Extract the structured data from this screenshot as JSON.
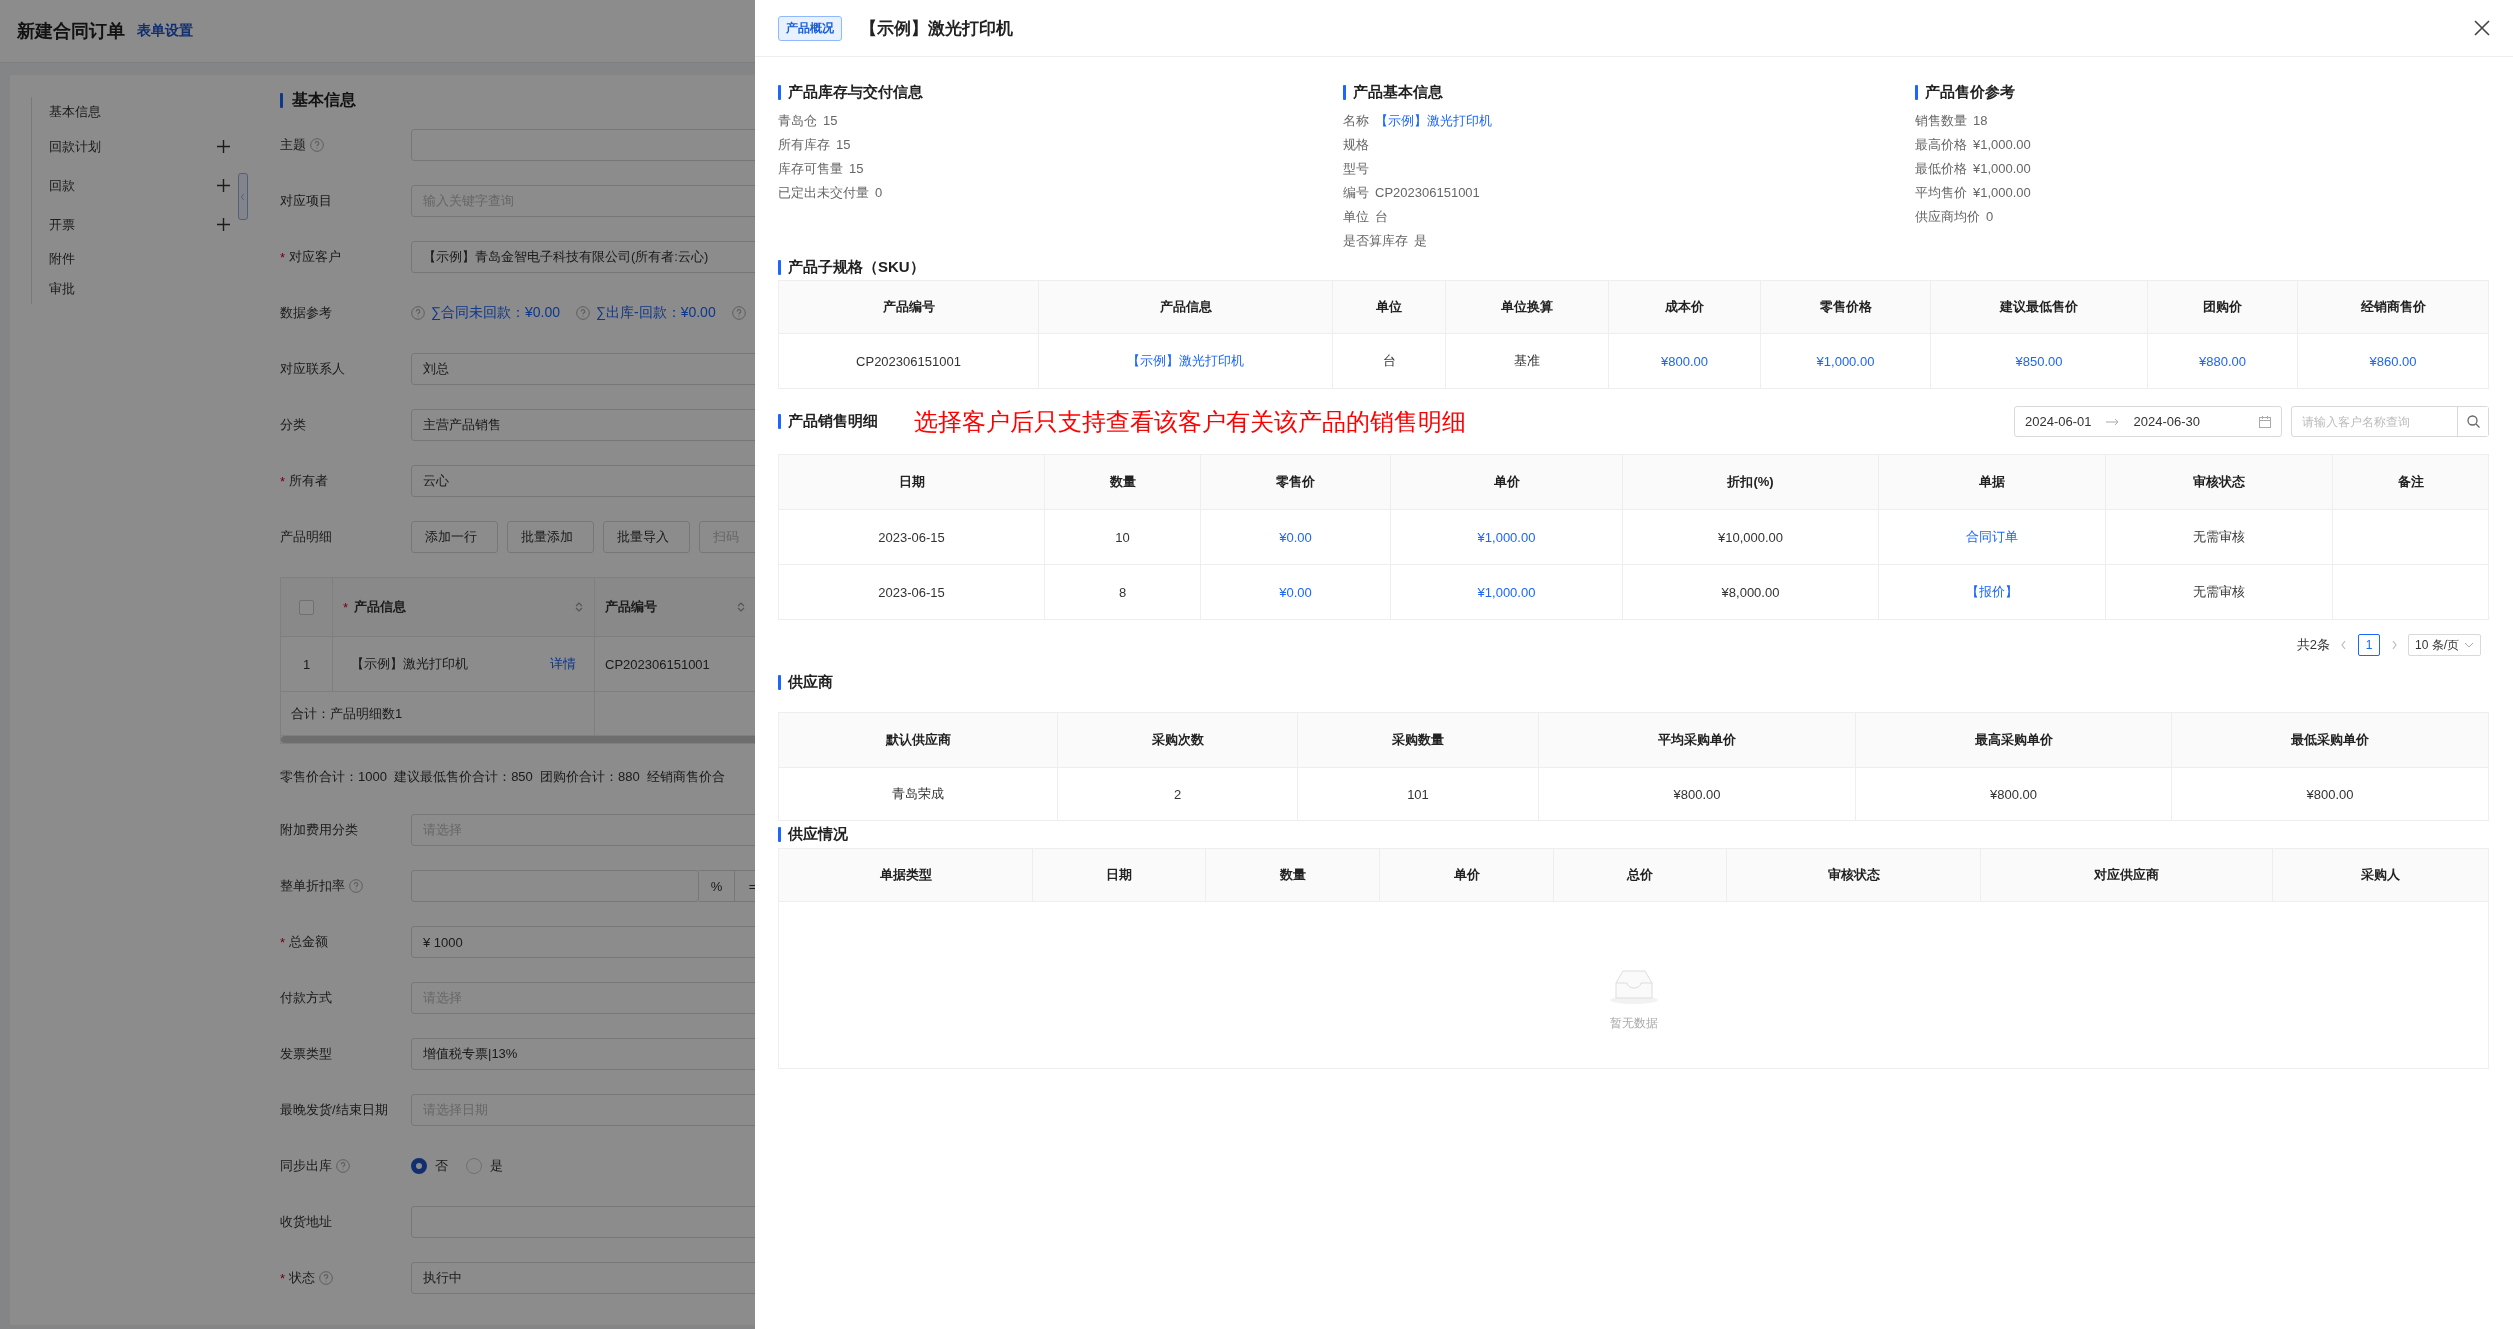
{
  "page": {
    "title": "新建合同订单",
    "settings_link": "表单设置"
  },
  "side_nav": [
    {
      "label": "基本信息",
      "addable": false
    },
    {
      "label": "回款计划",
      "addable": true
    },
    {
      "label": "回款",
      "addable": true
    },
    {
      "label": "开票",
      "addable": true
    },
    {
      "label": "附件",
      "addable": false
    },
    {
      "label": "审批",
      "addable": false
    }
  ],
  "form": {
    "section_title": "基本信息",
    "rows": [
      {
        "kind": "input",
        "label": "主题",
        "help": true
      },
      {
        "kind": "input",
        "label": "对应项目",
        "help": false,
        "placeholder": "输入关键字查询"
      },
      {
        "kind": "input",
        "label": "对应客户",
        "required_mark": "*",
        "help": false,
        "value": "【示例】青岛金智电子科技有限公司(所有者:云心)"
      },
      {
        "kind": "refs",
        "label": "数据参考",
        "help": false,
        "refs": [
          "∑合同未回款：¥0.00",
          "∑出库-回款：¥0.00"
        ]
      },
      {
        "kind": "input",
        "label": "对应联系人",
        "help": false,
        "value": "刘总"
      },
      {
        "kind": "input",
        "label": "分类",
        "help": false,
        "value": "主营产品销售"
      },
      {
        "kind": "input",
        "label": "所有者",
        "required_mark": "*",
        "help": false,
        "value": "云心"
      },
      {
        "kind": "buttons",
        "label": "产品明细",
        "help": false,
        "buttons": [
          {
            "label": "添加一行",
            "disabled": false
          },
          {
            "label": "批量添加",
            "disabled": false
          },
          {
            "label": "批量导入",
            "disabled": false
          },
          {
            "label": "扫码",
            "disabled": true
          }
        ]
      },
      {
        "kind": "table",
        "select_all_checked": false,
        "columns": [
          {
            "label": "产品信息",
            "required_mark": "*"
          },
          {
            "label": "产品编号"
          }
        ],
        "rows": [
          {
            "index": "1",
            "product": "【示例】激光打印机",
            "link": "详情",
            "code": "CP202306151001"
          }
        ],
        "footer": "合计：产品明细数1"
      },
      {
        "kind": "totals",
        "text": "零售价合计：1000  建议最低售价合计：850  团购价合计：880  经销商售价合"
      },
      {
        "kind": "input",
        "label": "附加费用分类",
        "help": false,
        "placeholder": "请选择"
      },
      {
        "kind": "discount",
        "label": "整单折扣率",
        "help": true,
        "suffix": "%",
        "tail": "="
      },
      {
        "kind": "input",
        "label": "总金额",
        "required_mark": "*",
        "help": false,
        "value": "¥ 1000"
      },
      {
        "kind": "input",
        "label": "付款方式",
        "help": false,
        "placeholder": "请选择"
      },
      {
        "kind": "input",
        "label": "发票类型",
        "help": false,
        "value": "增值税专票|13%"
      },
      {
        "kind": "input",
        "label": "最晚发货/结束日期",
        "help": false,
        "placeholder": "请选择日期"
      },
      {
        "kind": "radio",
        "label": "同步出库",
        "help": true,
        "options": [
          {
            "label": "否",
            "selected": true
          },
          {
            "label": "是",
            "selected": false
          }
        ]
      },
      {
        "kind": "input",
        "label": "收货地址",
        "help": false
      },
      {
        "kind": "input",
        "label": "状态",
        "required_mark": "*",
        "help": true,
        "value": "执行中"
      }
    ]
  },
  "drawer": {
    "tag": "产品概况",
    "title": "【示例】激光打印机",
    "info_sections": [
      {
        "title": "产品库存与交付信息",
        "items": [
          {
            "label": "青岛仓",
            "value": "15",
            "link": false
          },
          {
            "label": "所有库存",
            "value": "15",
            "link": false
          },
          {
            "label": "库存可售量",
            "value": "15",
            "link": false
          },
          {
            "label": "已定出未交付量",
            "value": "0",
            "link": false
          }
        ]
      },
      {
        "title": "产品基本信息",
        "items": [
          {
            "label": "名称",
            "value": "【示例】激光打印机",
            "link": true
          },
          {
            "label": "规格"
          },
          {
            "label": "型号"
          },
          {
            "label": "编号",
            "value": "CP202306151001",
            "link": false
          },
          {
            "label": "单位",
            "value": "台",
            "link": false
          },
          {
            "label": "是否算库存",
            "value": "是",
            "link": false
          }
        ]
      },
      {
        "title": "产品售价参考",
        "items": [
          {
            "label": "销售数量",
            "value": "18",
            "link": false
          },
          {
            "label": "最高价格",
            "value": "¥1,000.00",
            "link": false
          },
          {
            "label": "最低价格",
            "value": "¥1,000.00",
            "link": false
          },
          {
            "label": "平均售价",
            "value": "¥1,000.00",
            "link": false
          },
          {
            "label": "供应商均价",
            "value": "0",
            "link": false
          }
        ]
      }
    ],
    "sku": {
      "title": "产品子规格（SKU）",
      "columns": [
        {
          "label": "产品编号",
          "link": false
        },
        {
          "label": "产品信息",
          "link": true
        },
        {
          "label": "单位",
          "link": false
        },
        {
          "label": "单位换算",
          "link": false
        },
        {
          "label": "成本价",
          "link": true
        },
        {
          "label": "零售价格",
          "link": true
        },
        {
          "label": "建议最低售价",
          "link": true
        },
        {
          "label": "团购价",
          "link": true
        },
        {
          "label": "经销商售价",
          "link": true
        }
      ],
      "rows": [
        [
          "CP202306151001",
          "【示例】激光打印机",
          "台",
          "基准",
          "¥800.00",
          "¥1,000.00",
          "¥850.00",
          "¥880.00",
          "¥860.00"
        ]
      ]
    },
    "sales": {
      "title": "产品销售明细",
      "note": "选择客户后只支持查看该客户有关该产品的销售明细",
      "date_from": "2024-06-01",
      "date_to": "2024-06-30",
      "search_placeholder": "请输入客户名称查询",
      "columns": [
        {
          "label": "日期",
          "link": false
        },
        {
          "label": "数量",
          "link": false
        },
        {
          "label": "零售价",
          "link": true
        },
        {
          "label": "单价",
          "link": true
        },
        {
          "label": "折扣(%)",
          "link": false
        },
        {
          "label": "单据",
          "link": true
        },
        {
          "label": "审核状态",
          "link": false
        },
        {
          "label": "备注"
        }
      ],
      "rows": [
        [
          "2023-06-15",
          "10",
          "¥0.00",
          "¥1,000.00",
          "¥10,000.00",
          "合同订单",
          "无需审核",
          null
        ],
        [
          "2023-06-15",
          "8",
          "¥0.00",
          "¥1,000.00",
          "¥8,000.00",
          "【报价】",
          "无需审核",
          null
        ]
      ],
      "pagination": {
        "total": "共2条",
        "pages": [
          {
            "label": "1",
            "selected": true
          }
        ],
        "page_size": "10 条/页"
      }
    },
    "suppliers": {
      "title": "供应商",
      "columns": [
        {
          "label": "默认供应商",
          "link": false
        },
        {
          "label": "采购次数",
          "link": false
        },
        {
          "label": "采购数量",
          "link": false
        },
        {
          "label": "平均采购单价",
          "link": false
        },
        {
          "label": "最高采购单价",
          "link": false
        },
        {
          "label": "最低采购单价",
          "link": false
        }
      ],
      "rows": [
        [
          "青岛荣成",
          "2",
          "101",
          "¥800.00",
          "¥800.00",
          "¥800.00"
        ]
      ]
    },
    "supply": {
      "title": "供应情况",
      "columns": [
        {
          "label": "单据类型"
        },
        {
          "label": "日期"
        },
        {
          "label": "数量"
        },
        {
          "label": "单价"
        },
        {
          "label": "总价"
        },
        {
          "label": "审核状态"
        },
        {
          "label": "对应供应商"
        },
        {
          "label": "采购人"
        }
      ],
      "empty_text": "暂无数据"
    }
  }
}
